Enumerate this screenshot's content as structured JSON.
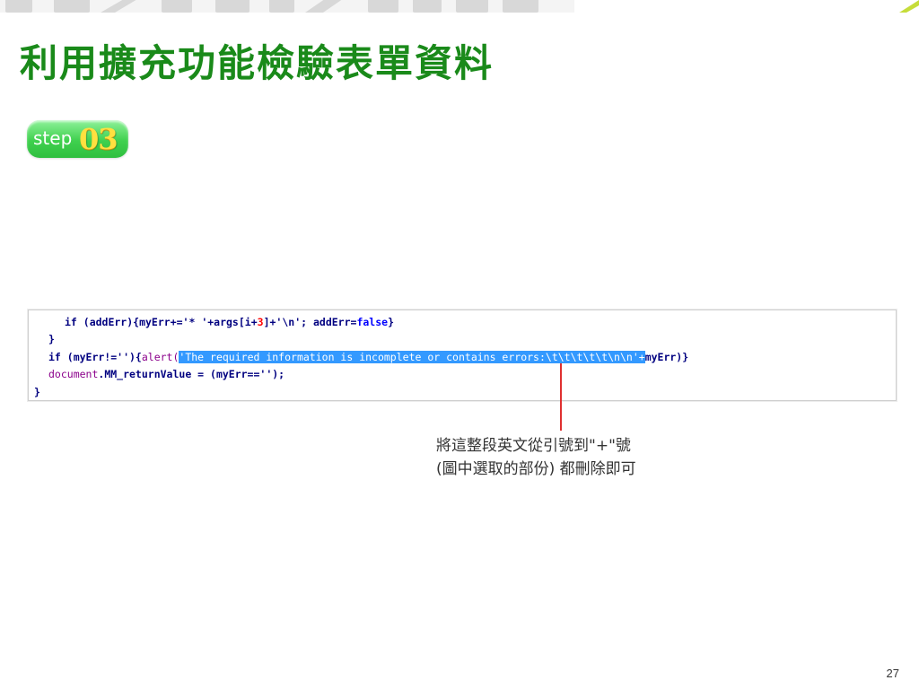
{
  "title": "利用擴充功能檢驗表單資料",
  "step": {
    "word": "step",
    "number": "03"
  },
  "code": {
    "line1": {
      "a": "if (addErr){myErr+='* '+args[i+",
      "num": "3",
      "b": "]+'\\n'; addErr=",
      "kw": "false",
      "c": "}"
    },
    "line2": "}",
    "line3": {
      "a": "if (myErr!=''){",
      "fn": "alert(",
      "selected": "'The required information is incomplete or contains errors:\\t\\t\\t\\t\\t\\n\\n'+",
      "b": "myErr)}"
    },
    "line4": {
      "obj": "document",
      "b": ".MM_returnValue = (myErr=='');"
    },
    "line5": "}"
  },
  "annotation": {
    "line1": "將這整段英文從引號到\"+\"號",
    "line2": "(圖中選取的部份) 都刪除即可"
  },
  "page_number": "27",
  "colors": {
    "title": "#1a8a1a",
    "badge": "#3fd04e",
    "selection": "#3399ff",
    "pointer": "#e03030"
  }
}
